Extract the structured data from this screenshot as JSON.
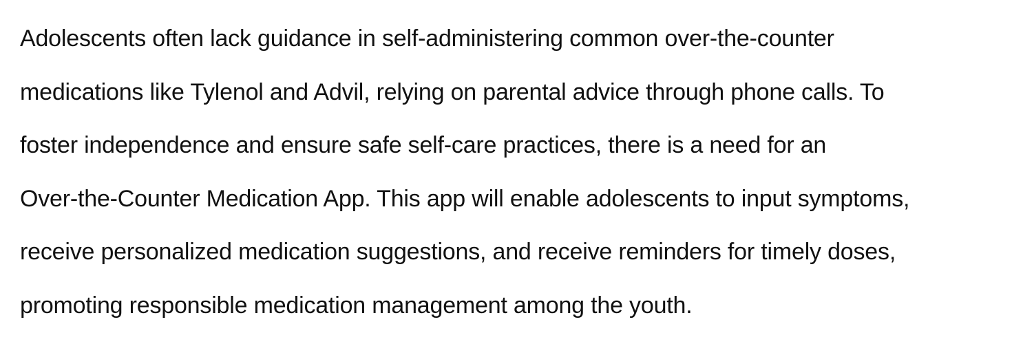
{
  "document": {
    "lines": [
      "Adolescents often lack guidance in self-administering common over-the-counter",
      "medications like Tylenol and Advil, relying on parental advice through phone calls. To",
      "foster independence and ensure safe self-care practices, there is a need for an",
      "Over-the-Counter Medication App. This app will enable adolescents to input symptoms,",
      "receive personalized medication suggestions, and receive reminders for timely doses,",
      "promoting responsible medication management among the youth."
    ]
  }
}
